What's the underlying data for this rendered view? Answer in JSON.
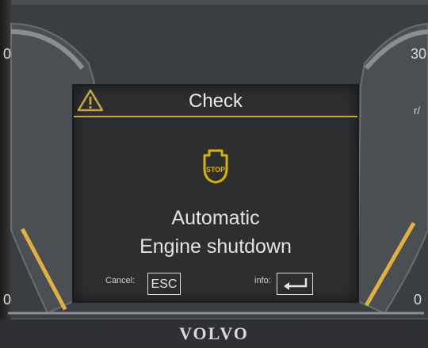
{
  "dashboard": {
    "brand": "VOLVO",
    "left_gauge": {
      "top_tick": "0",
      "bottom_tick": "0"
    },
    "right_gauge": {
      "top_tick": "30",
      "unit_tick": "r/",
      "bottom_tick": "0"
    }
  },
  "display": {
    "title": "Check",
    "warning_icon": "warning-triangle-icon",
    "status_icon": "engine-stop-icon",
    "status_icon_text": "STOP",
    "message_line1": "Automatic",
    "message_line2": "Engine shutdown",
    "cancel_label": "Cancel:",
    "esc_label": "ESC",
    "info_label": "info:",
    "enter_icon": "enter-return-icon"
  },
  "colors": {
    "accent": "#c9a83a",
    "screen": "#2d2e30",
    "text": "#e4e4e4"
  }
}
